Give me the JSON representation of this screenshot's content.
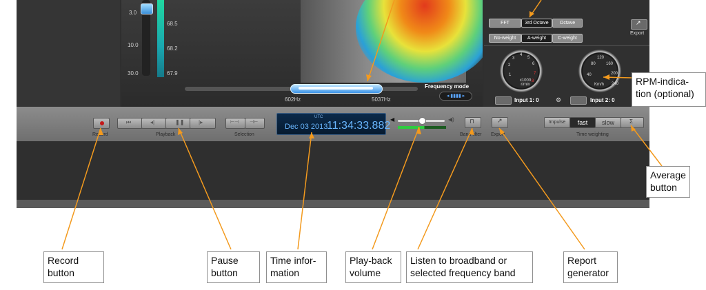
{
  "heat_view": {
    "scale_ticks": [
      "3.0",
      "10.0",
      "30.0"
    ],
    "level_ticks": [
      "68.5",
      "68.2",
      "67.9"
    ],
    "freq_min": "602Hz",
    "freq_max": "5037Hz",
    "freq_mode_label": "Frequency mode"
  },
  "right_pane": {
    "analysis_modes": [
      "FFT",
      "3rd Octave",
      "Octave"
    ],
    "weightings": [
      "No-weight",
      "A-weight",
      "C-weight"
    ],
    "export_label": "Export",
    "gauge1": {
      "ticks": [
        "1",
        "2",
        "3",
        "4",
        "5",
        "6",
        "7",
        "8"
      ],
      "unit": "x1000 r/min"
    },
    "gauge2": {
      "ticks": [
        "40",
        "80",
        "120",
        "160",
        "200",
        "240"
      ],
      "unit": "Km/h"
    },
    "input1": "Input 1: 0",
    "input2": "Input 2: 0"
  },
  "transport": {
    "record_label": "Record",
    "playback_label": "Playback",
    "selection_label": "Selection",
    "utc_label": "UTC",
    "date": "Dec 03 2013",
    "time": "11:34:33.882",
    "band_filter_label": "Band filter",
    "export_label": "Export",
    "time_weighting_label": "Time weighting",
    "time_weighting_options": [
      "Impulse",
      "fast",
      "slow"
    ]
  },
  "annotations": {
    "rpm": "RPM-indica-\ntion (optional)",
    "average": "Average\nbutton",
    "record": "Record\nbutton",
    "pause": "Pause\nbutton",
    "time": "Time infor-\nmation",
    "volume": "Play-back\nvolume",
    "listen": "Listen to broadband or\nselected frequency band",
    "report": "Report\ngenerator"
  },
  "colors": {
    "accent": "#69b6ff",
    "arrow": "#f39a1e",
    "record": "#c41818"
  }
}
